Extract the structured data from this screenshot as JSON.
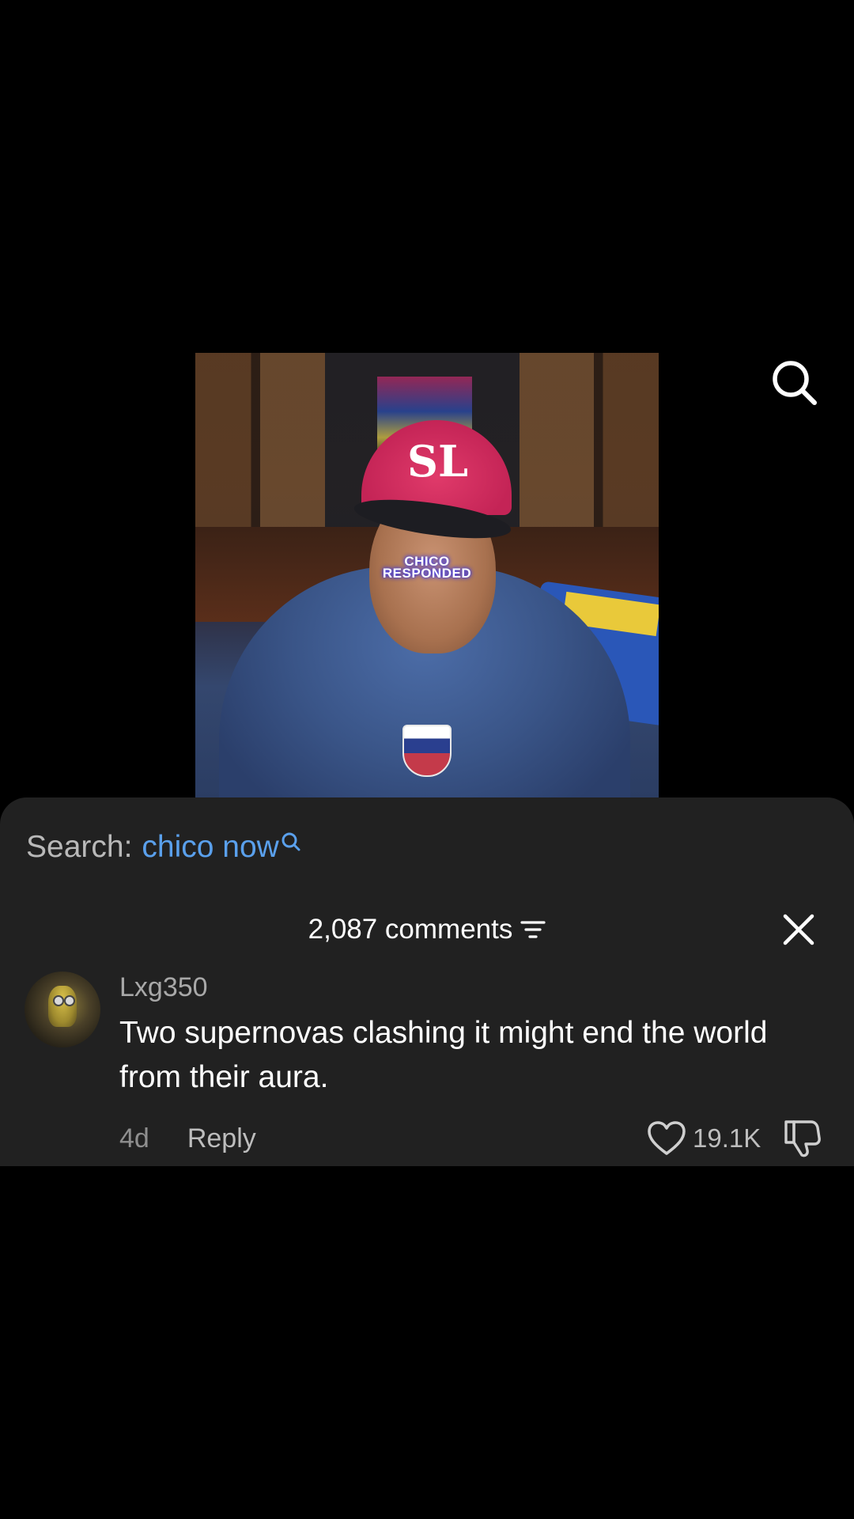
{
  "video": {
    "caption_line1": "CHICO",
    "caption_line2": "RESPONDED",
    "logo_glyph": "SL"
  },
  "top_bar": {
    "search_icon": "search-icon"
  },
  "search_suggestion": {
    "prefix": "Search:",
    "term": "chico now",
    "icon": "search-icon"
  },
  "comments": {
    "count_label": "2,087 comments",
    "filter_icon": "filter-icon",
    "close_icon": "close-icon",
    "items": [
      {
        "username": "Lxg350",
        "text": "Two supernovas clashing it might end the world from their aura.",
        "time": "4d",
        "reply_label": "Reply",
        "likes": "19.1K",
        "like_icon": "heart-icon",
        "dislike_icon": "thumbs-down-icon"
      }
    ]
  },
  "colors": {
    "background": "#000000",
    "sheet": "#212121",
    "accent_link": "#5aa0ec",
    "text_primary": "#ffffff",
    "text_secondary": "#a8a8a8"
  }
}
